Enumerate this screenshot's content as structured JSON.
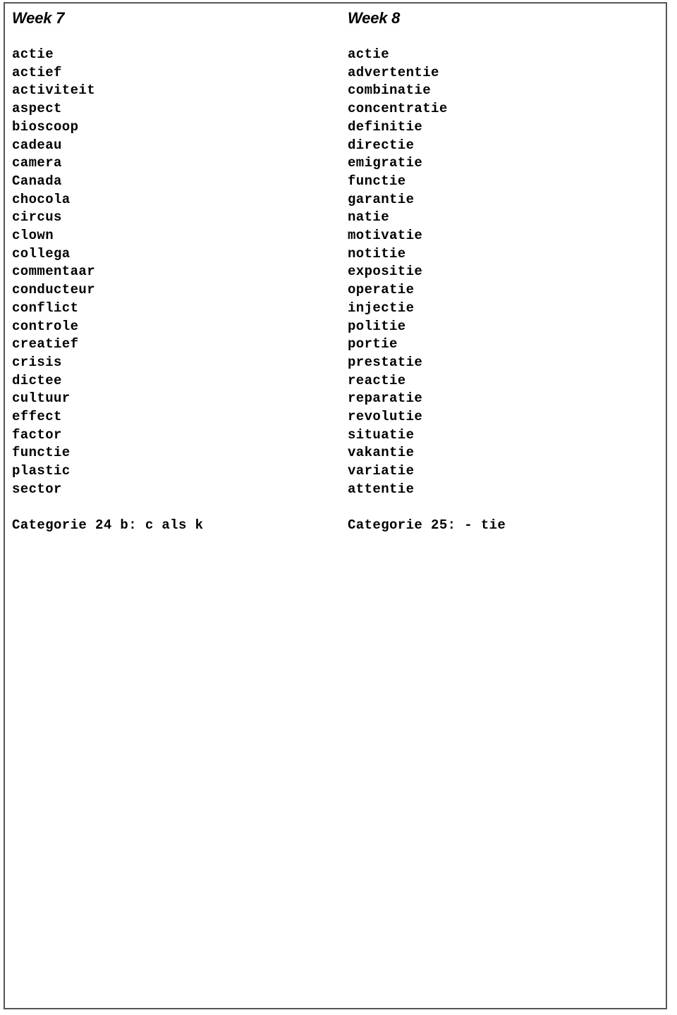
{
  "document": {
    "type": "spelling-word-list",
    "column_count": 2
  },
  "columns": [
    {
      "heading": "Week 7",
      "words": [
        "actie",
        "actief",
        "activiteit",
        "aspect",
        "bioscoop",
        "cadeau",
        "camera",
        "Canada",
        "chocola",
        "circus",
        "clown",
        "collega",
        "commentaar",
        "conducteur",
        "conflict",
        "controle",
        "creatief",
        "crisis",
        "dictee",
        "cultuur",
        "effect",
        "factor",
        "functie",
        "plastic",
        "sector"
      ],
      "categorie": "Categorie 24 b: c als k"
    },
    {
      "heading": "Week 8",
      "words": [
        "actie",
        "advertentie",
        "combinatie",
        "concentratie",
        "definitie",
        "directie",
        "emigratie",
        "functie",
        "garantie",
        "natie",
        "motivatie",
        "notitie",
        "expositie",
        "operatie",
        "injectie",
        "politie",
        "portie",
        "prestatie",
        "reactie",
        "reparatie",
        "revolutie",
        "situatie",
        "vakantie",
        "variatie",
        "attentie"
      ],
      "categorie": "Categorie 25: - tie"
    }
  ],
  "colors": {
    "text": "#000000",
    "border": "#555555",
    "background": "#ffffff"
  }
}
